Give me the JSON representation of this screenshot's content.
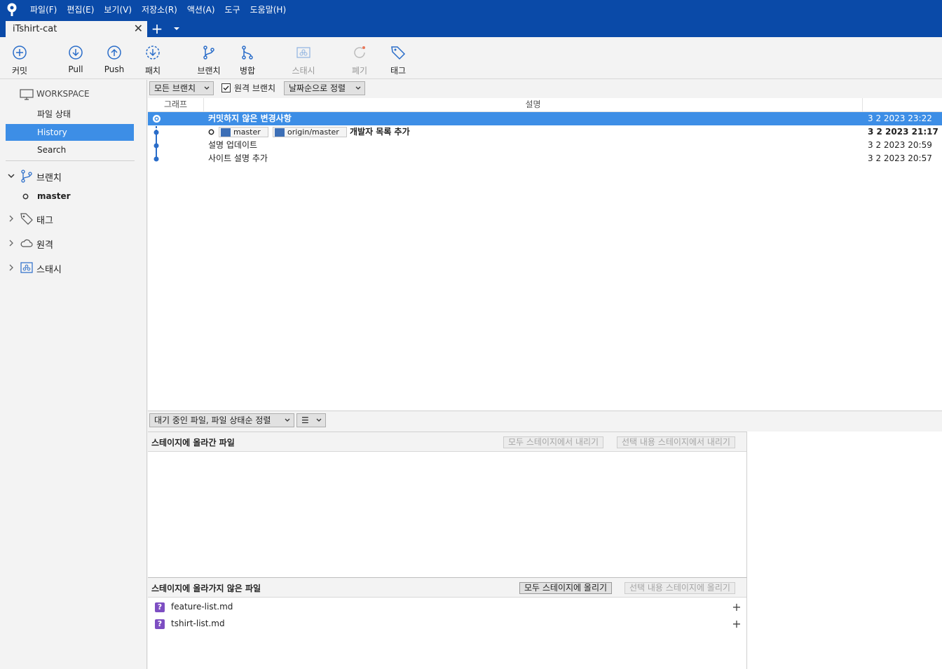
{
  "menu": [
    "파일(F)",
    "편집(E)",
    "보기(V)",
    "저장소(R)",
    "액션(A)",
    "도구",
    "도움말(H)"
  ],
  "tab": {
    "title": "iTshirt-cat"
  },
  "toolbar": {
    "commit": "커밋",
    "pull": "Pull",
    "push": "Push",
    "fetch": "패치",
    "branch": "브랜치",
    "merge": "병합",
    "stash": "스태시",
    "discard": "폐기",
    "tag": "태그"
  },
  "sidebar": {
    "workspace": "WORKSPACE",
    "file_status": "파일 상태",
    "history": "History",
    "search": "Search",
    "branches": "브랜치",
    "current_branch": "master",
    "tags": "태그",
    "remotes": "원격",
    "stashes": "스태시"
  },
  "filters": {
    "branches": "모든 브랜치",
    "remote_branches": "원격 브랜치",
    "sort": "날짜순으로 정렬"
  },
  "history_columns": {
    "graph": "그래프",
    "description": "설명"
  },
  "commits": [
    {
      "message": "커밋하지 않은 변경사항",
      "date": "3 2 2023 23:22"
    },
    {
      "message": "개발자 목록 추가",
      "date": "3 2 2023 21:17",
      "refs": [
        "master",
        "origin/master"
      ]
    },
    {
      "message": "설명 업데이트",
      "date": "3 2 2023 20:59"
    },
    {
      "message": "사이트 설명 추가",
      "date": "3 2 2023 20:57"
    }
  ],
  "lower": {
    "sort_dropdown": "대기 중인 파일, 파일 상태순 정렬",
    "view_dropdown": "☰"
  },
  "staged": {
    "title": "스테이지에 올라간 파일",
    "unstage_all": "모두 스테이지에서 내리기",
    "unstage_selected": "선택 내용 스테이지에서 내리기"
  },
  "unstaged": {
    "title": "스테이지에 올라가지 않은 파일",
    "stage_all": "모두 스테이지에 올리기",
    "stage_selected": "선택 내용 스테이지에 올리기",
    "files": [
      "feature-list.md",
      "tshirt-list.md"
    ]
  },
  "colors": {
    "accent": "#0a4aa8",
    "selection": "#3d8ee6",
    "untracked": "#7d4ec2"
  }
}
